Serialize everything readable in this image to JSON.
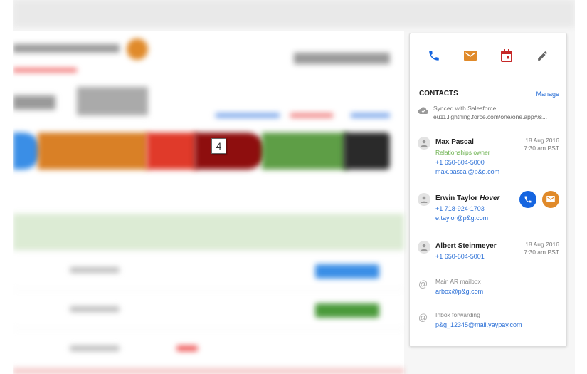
{
  "marker": {
    "label": "4"
  },
  "panel": {
    "actions": [
      {
        "icon": "phone-icon",
        "color": "#1565e0"
      },
      {
        "icon": "mail-icon",
        "color": "#e08a2a"
      },
      {
        "icon": "calendar-icon",
        "color": "#c62828"
      },
      {
        "icon": "pencil-icon",
        "color": "#666666"
      }
    ],
    "title": "CONTACTS",
    "manage": "Manage",
    "sync": {
      "label": "Synced with Salesforce:",
      "url": "eu11.lightning.force.com/one/one.app#/s..."
    },
    "contacts": [
      {
        "name": "Max Pascal",
        "role": "Relationships owner",
        "phone": "+1 650-604-5000",
        "email": "max.pascal@p&g.com",
        "date": "18 Aug 2016",
        "time": "7:30 am PST"
      },
      {
        "name": "Erwin Taylor",
        "hover": "Hover",
        "phone": "+1 718-924-1703",
        "email": "e.taylor@p&g.com"
      },
      {
        "name": "Albert Steinmeyer",
        "phone": "+1 650-604-5001",
        "date": "18 Aug 2016",
        "time": "7:30 am PST"
      }
    ],
    "mailboxes": [
      {
        "label": "Main AR mailbox",
        "email": "arbox@p&g.com"
      },
      {
        "label": "Inbox forwarding",
        "email": "p&g_12345@mail.yaypay.com"
      }
    ]
  }
}
